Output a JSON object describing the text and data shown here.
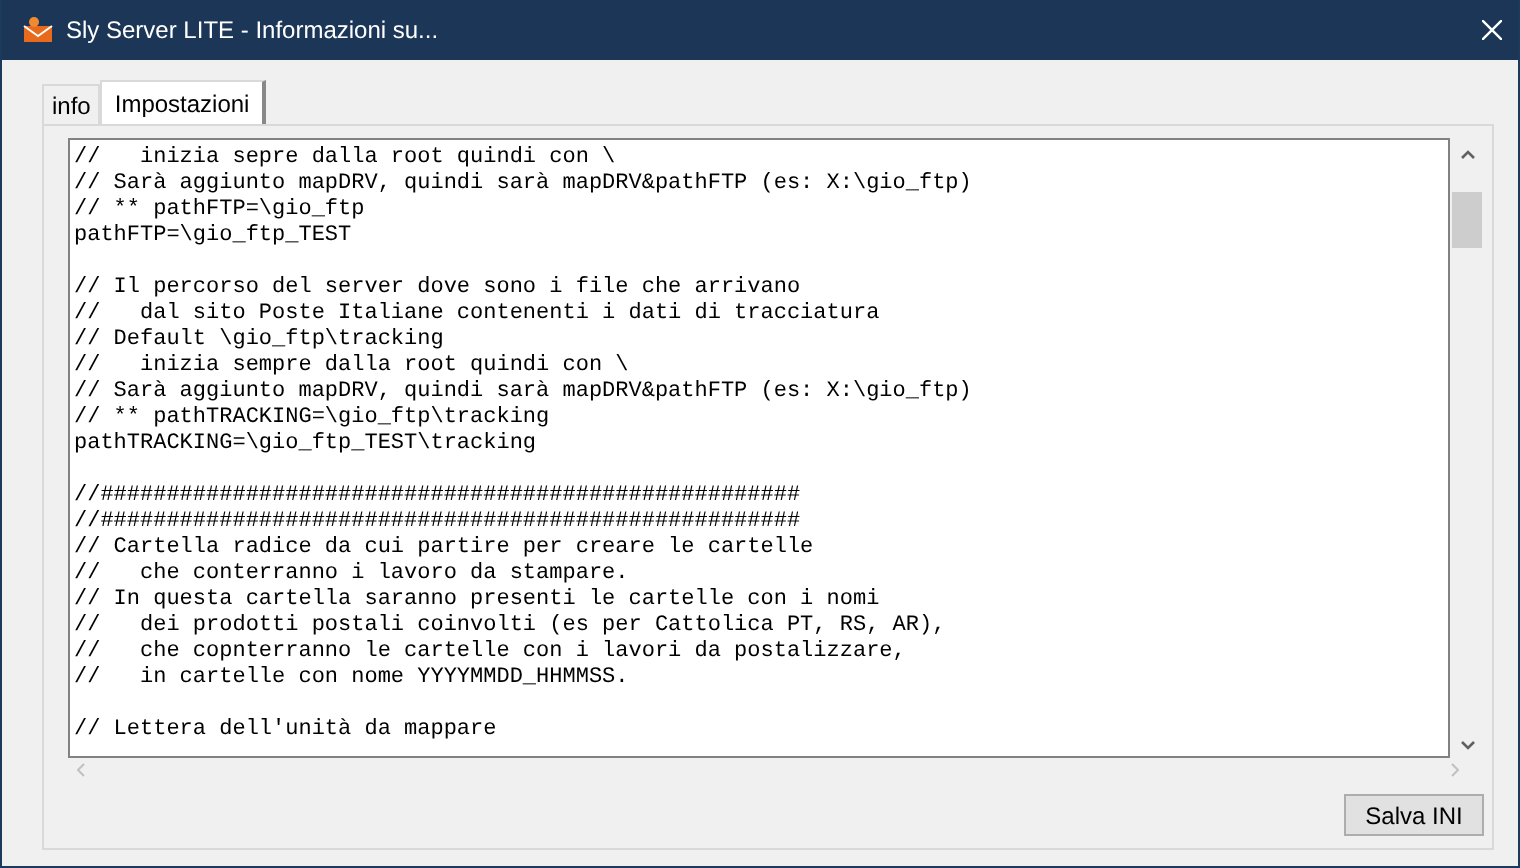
{
  "window": {
    "title": "Sly Server LITE - Informazioni su..."
  },
  "tabs": [
    {
      "label": "info",
      "selected": false
    },
    {
      "label": "Impostazioni",
      "selected": true
    }
  ],
  "editor": {
    "blocks": [
      [
        "//   inizia sepre dalla root quindi con \\",
        "// Sarà aggiunto mapDRV, quindi sarà mapDRV&pathFTP (es: X:\\gio_ftp)",
        "// ** pathFTP=\\gio_ftp",
        "pathFTP=\\gio_ftp_TEST"
      ],
      [
        "// Il percorso del server dove sono i file che arrivano",
        "//   dal sito Poste Italiane contenenti i dati di tracciatura",
        "// Default \\gio_ftp\\tracking",
        "//   inizia sempre dalla root quindi con \\",
        "// Sarà aggiunto mapDRV, quindi sarà mapDRV&pathFTP (es: X:\\gio_ftp)",
        "// ** pathTRACKING=\\gio_ftp\\tracking",
        "pathTRACKING=\\gio_ftp_TEST\\tracking"
      ],
      [
        "//#####################################################",
        "//#####################################################",
        "// Cartella radice da cui partire per creare le cartelle",
        "//   che conterranno i lavoro da stampare.",
        "// In questa cartella saranno presenti le cartelle con i nomi",
        "//   dei prodotti postali coinvolti (es per Cattolica PT, RS, AR),",
        "//   che copnterranno le cartelle con i lavori da postalizzare,",
        "//   in cartelle con nome YYYYMMDD_HHMMSS."
      ],
      [
        "// Lettera dell'unità da mappare"
      ]
    ]
  },
  "buttons": [
    {
      "label": "Salva INI"
    }
  ]
}
